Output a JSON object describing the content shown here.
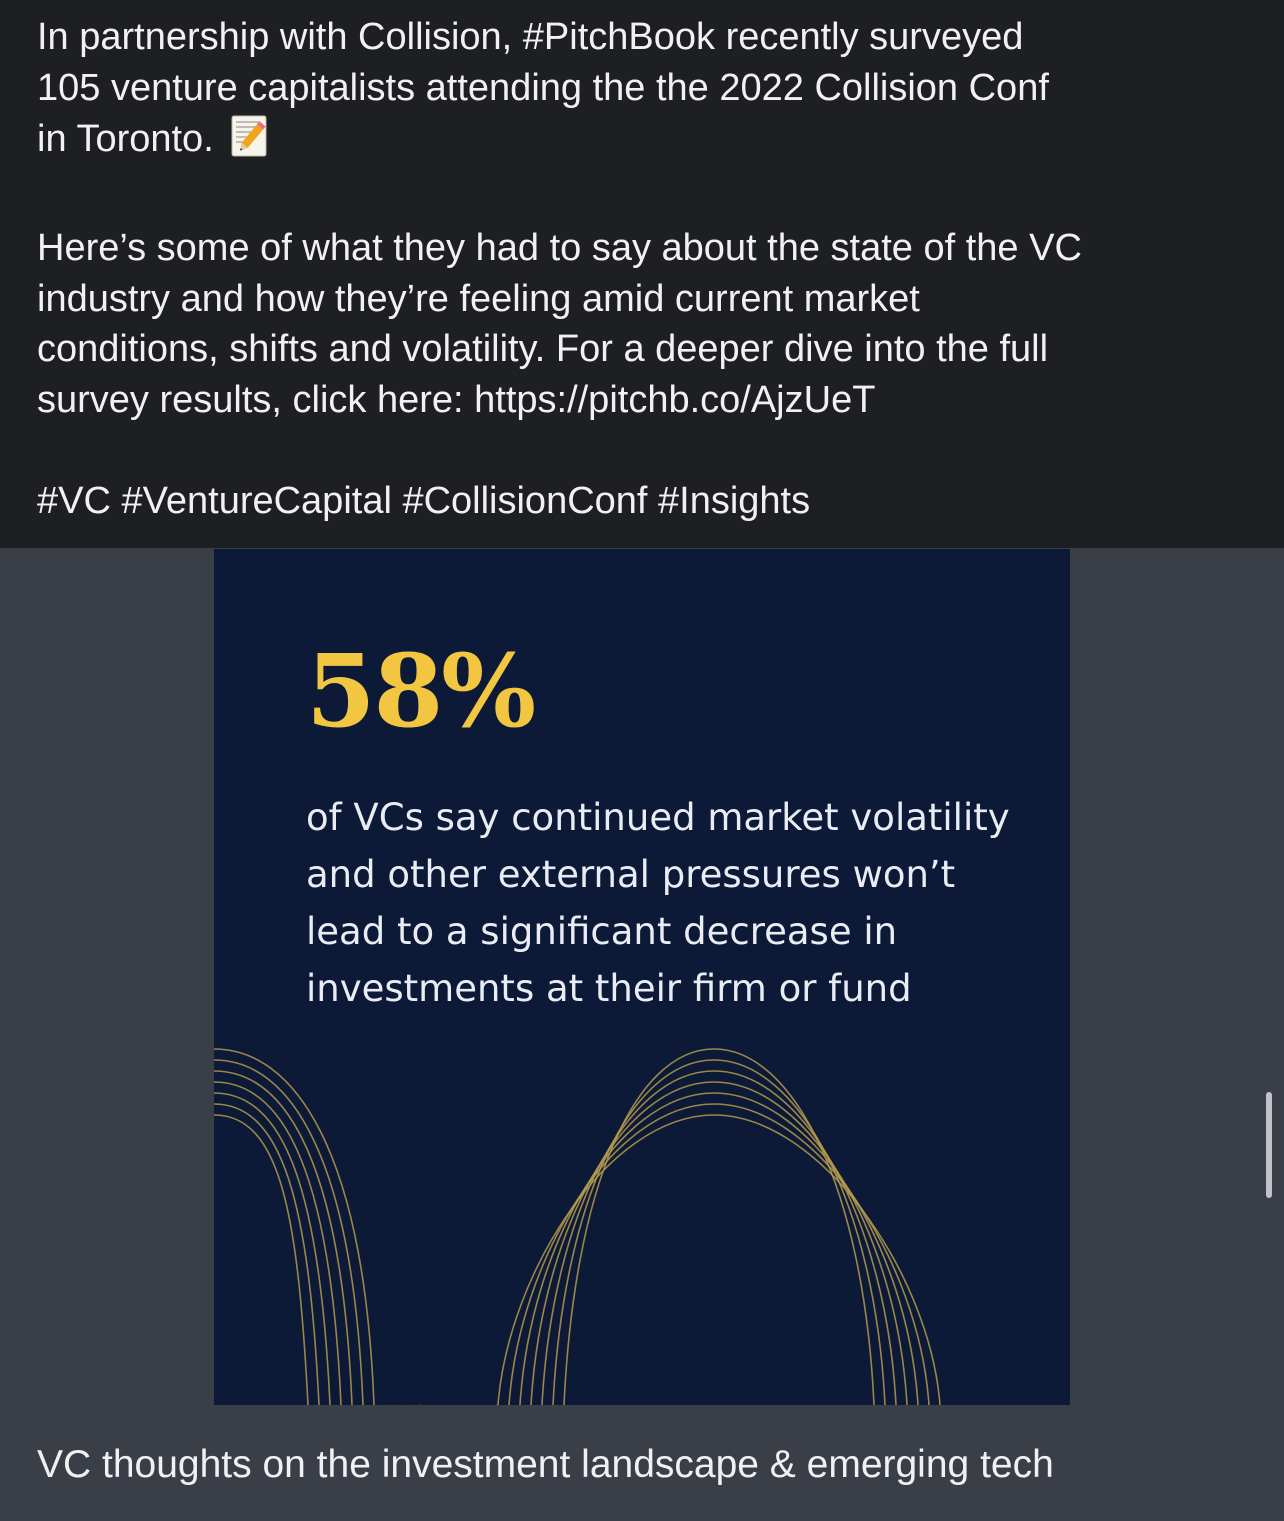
{
  "post": {
    "paragraph1_line1": "In partnership with Collision, #PitchBook recently surveyed",
    "paragraph1_line2": "105 venture capitalists attending the the 2022 Collision Conf",
    "paragraph1_line3": "in Toronto.",
    "paragraph1_emoji": "memo-icon",
    "paragraph2_line1": "Here’s some of what they had to say about the state of the VC",
    "paragraph2_line2": "industry and how they’re feeling amid current market",
    "paragraph2_line3": "conditions, shifts and volatility. For a deeper dive into the full",
    "paragraph2_line4": "survey results, click here: https://pitchb.co/AjzUeT",
    "hashtags": "#VC #VentureCapital #CollisionConf #Insights"
  },
  "card": {
    "stat": "58%",
    "desc_line1": "of VCs say continued market volatility",
    "desc_line2": "and other external pressures won’t",
    "desc_line3": "lead to a significant decrease in",
    "desc_line4": "investments at their firm or fund",
    "colors": {
      "background": "#0c1a38",
      "accent": "#f2c641",
      "line": "#b59a4e"
    }
  },
  "caption": "VC thoughts on the investment landscape & emerging tech",
  "colors": {
    "page_background": "#3a3e47",
    "post_background": "#1d1f23",
    "text": "#f1f1f3"
  }
}
